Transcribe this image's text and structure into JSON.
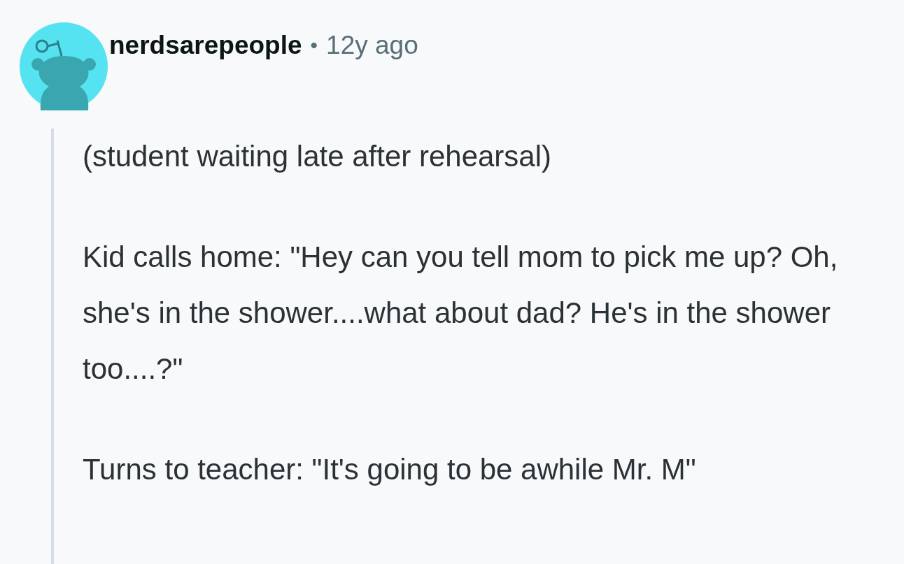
{
  "comment": {
    "author": "nerdsarepeople",
    "separator": "•",
    "time": "12y ago",
    "paragraphs": [
      "(student waiting late after rehearsal)",
      "Kid calls home: \"Hey can you tell mom to pick me up? Oh, she's in the shower....what about dad? He's in the shower too....?\"",
      "Turns to teacher: \"It's going to be awhile Mr. M\""
    ]
  }
}
